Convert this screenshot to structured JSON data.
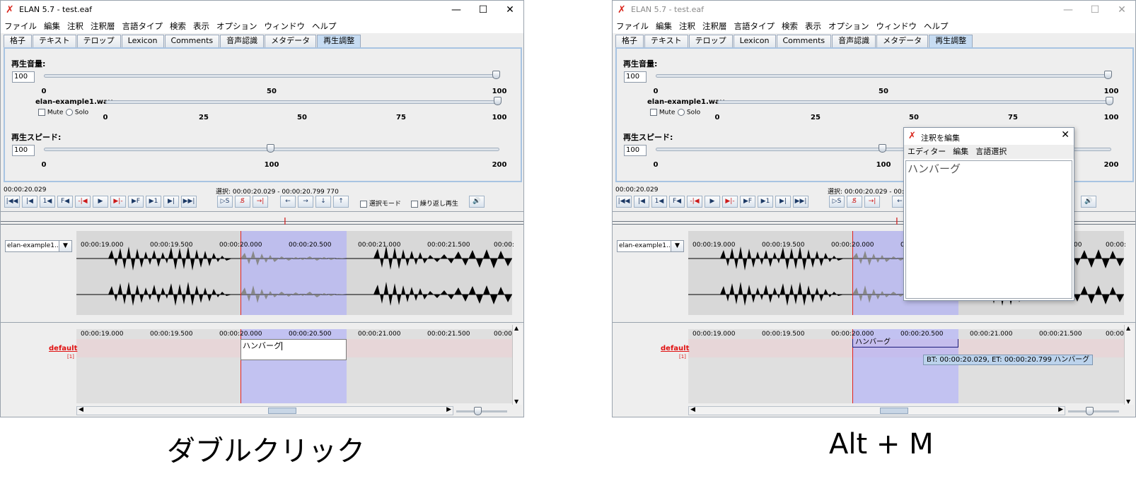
{
  "window": {
    "title": "ELAN 5.7 - test.eaf",
    "minimize": "—",
    "maximize": "☐",
    "close": "✕"
  },
  "menu": [
    "ファイル",
    "編集",
    "注釈",
    "注釈層",
    "言語タイプ",
    "検索",
    "表示",
    "オプション",
    "ウィンドウ",
    "ヘルプ"
  ],
  "tabs": [
    "格子",
    "テキスト",
    "テロップ",
    "Lexicon",
    "Comments",
    "音声認識",
    "メタデータ",
    "再生調整"
  ],
  "active_tab": "再生調整",
  "volume": {
    "label": "再生音量:",
    "value": "100",
    "level": 100,
    "ticks": [
      "0",
      "50",
      "100"
    ]
  },
  "track": {
    "name": "elan-example1.wav",
    "mute": "Mute",
    "solo": "Solo",
    "level": 100,
    "ticks": [
      "0",
      "25",
      "50",
      "75",
      "100"
    ]
  },
  "speed": {
    "label": "再生スピード:",
    "value": "100",
    "level": 100,
    "ticks": [
      "0",
      "100",
      "200"
    ]
  },
  "time": {
    "current": "00:00:20.029",
    "selection": "選択: 00:00:20.029 - 00:00:20.799  770",
    "selection_truncated": "選択: 00:00:20.029 - 00:00"
  },
  "toolbar_right": {
    "select_mode": "選択モード",
    "loop": "繰り返し再生"
  },
  "waveform": {
    "combo": "elan-example1....",
    "combo_arrow": "▼",
    "ruler": [
      "00:00:19.000",
      "00:00:19.500",
      "00:00:20.000",
      "00:00:20.500",
      "00:00:21.000",
      "00:00:21.500",
      "00:00:"
    ]
  },
  "tier": {
    "name": "default",
    "count": "[1]"
  },
  "annotation": {
    "text": "ハンバーグ",
    "tooltip": "BT: 00:00:20.029, ET: 00:00:20.799 ハンバーグ"
  },
  "dialog": {
    "title": "注釈を編集",
    "menu": [
      "エディター",
      "編集",
      "言語選択"
    ],
    "text": "ハンバーグ",
    "close": "✕"
  },
  "captions": {
    "left": "ダブルクリック",
    "right": "Alt + M"
  }
}
